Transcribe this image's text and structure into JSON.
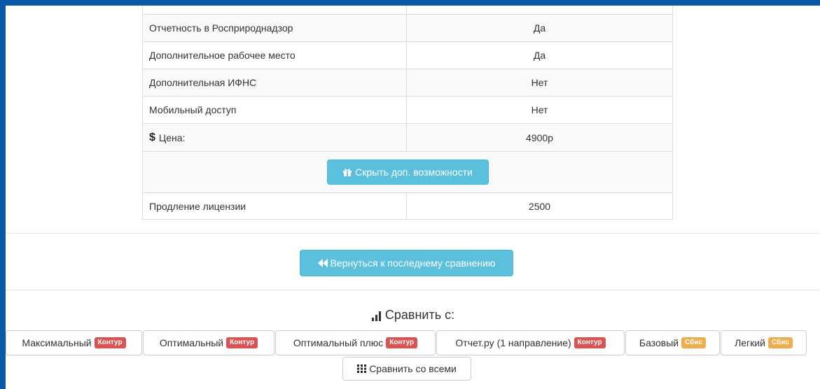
{
  "table": {
    "rows": [
      {
        "label": "Отчетность в Росприроднадзор",
        "value": "Да"
      },
      {
        "label": "Дополнительное рабочее место",
        "value": "Да"
      },
      {
        "label": "Дополнительная ИФНС",
        "value": "Нет"
      },
      {
        "label": "Мобильный доступ",
        "value": "Нет"
      }
    ],
    "price": {
      "symbol": "$",
      "label": "Цена:",
      "value": "4900р"
    },
    "hide_button": "Скрыть доп. возможности",
    "renewal": {
      "label": "Продление лицензии",
      "value": "2500"
    }
  },
  "back_button": "Вернуться к последнему сравнению",
  "compare": {
    "title": "Сравнить с:",
    "variants": [
      {
        "name": "Максимальный",
        "badge": "Контур",
        "badge_color": "#d9534f"
      },
      {
        "name": "Оптимальный",
        "badge": "Контур",
        "badge_color": "#d9534f"
      },
      {
        "name": "Оптимальный плюс",
        "badge": "Контур",
        "badge_color": "#d9534f"
      },
      {
        "name": "Отчет.ру (1 направление)",
        "badge": "Контур",
        "badge_color": "#d9534f"
      },
      {
        "name": "Базовый",
        "badge": "Сбис",
        "badge_color": "#f0ad4e"
      },
      {
        "name": "Легкий",
        "badge": "Сбис",
        "badge_color": "#f0ad4e"
      }
    ],
    "compare_all": "Сравнить со всеми"
  },
  "colors": {
    "frame": "#0b58a8",
    "info_button": "#5bc0de"
  },
  "icons": {
    "price": "dollar-icon",
    "hide": "gift-icon",
    "back": "backward-icon",
    "compare": "signal-icon",
    "all": "grid-icon"
  }
}
